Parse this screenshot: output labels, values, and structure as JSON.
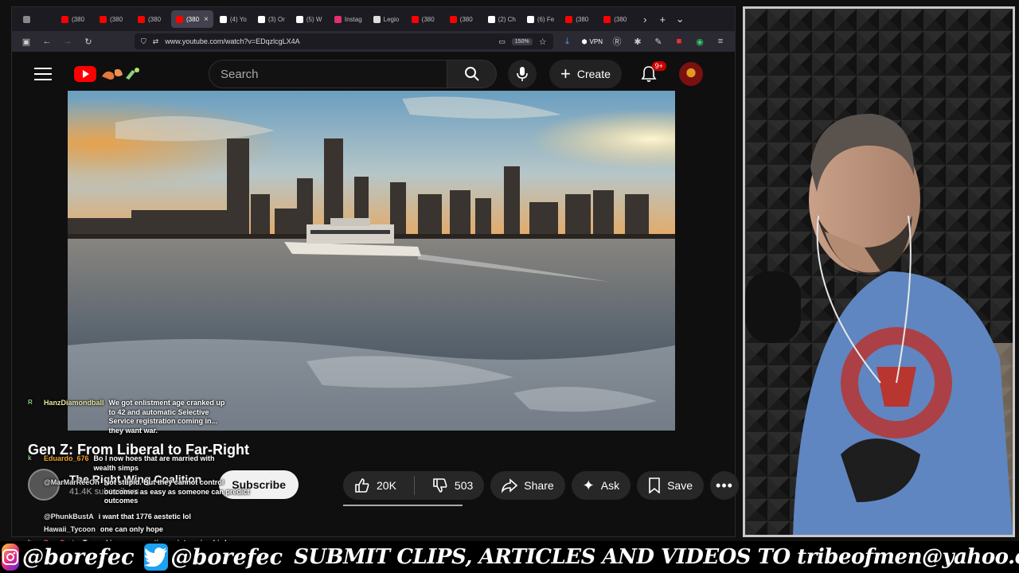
{
  "browser": {
    "tabs": [
      {
        "label": "",
        "icon": "tabs-icon",
        "color": "#888888"
      },
      {
        "label": "(380",
        "icon": "youtube-icon",
        "color": "#ff0000"
      },
      {
        "label": "(380",
        "icon": "youtube-icon",
        "color": "#ff0000"
      },
      {
        "label": "(380",
        "icon": "youtube-icon",
        "color": "#ff0000"
      },
      {
        "label": "(380",
        "icon": "youtube-icon",
        "color": "#ff0000",
        "active": true
      },
      {
        "label": "(4) Yo",
        "icon": "x-icon",
        "color": "#ffffff"
      },
      {
        "label": "(3) Or",
        "icon": "x-icon",
        "color": "#ffffff"
      },
      {
        "label": "(5) W",
        "icon": "x-icon",
        "color": "#ffffff"
      },
      {
        "label": "Instag",
        "icon": "instagram-icon",
        "color": "#e1306c"
      },
      {
        "label": "Legio",
        "icon": "legion-icon",
        "color": "#dddddd"
      },
      {
        "label": "(380",
        "icon": "youtube-icon",
        "color": "#ff0000"
      },
      {
        "label": "(380",
        "icon": "youtube-icon",
        "color": "#ff0000"
      },
      {
        "label": "(2) Ch",
        "icon": "x-icon",
        "color": "#ffffff"
      },
      {
        "label": "(6) Fe",
        "icon": "x-icon",
        "color": "#ffffff"
      },
      {
        "label": "(380",
        "icon": "youtube-icon",
        "color": "#ff0000"
      },
      {
        "label": "(380",
        "icon": "youtube-icon",
        "color": "#ff0000"
      }
    ],
    "url": "www.youtube.com/watch?v=EDqzlcgLX4A",
    "zoom": "150%",
    "vpn": "VPN"
  },
  "youtube": {
    "search_placeholder": "Search",
    "create_label": "Create",
    "notification_count": "9+",
    "video_title": "Gen Z: From Liberal to Far-Right",
    "channel_name": "The Right Wing Coalition",
    "subscribers": "41.4K subscribers",
    "subscribe_label": "Subscribe",
    "likes": "20K",
    "dislikes": "503",
    "share_label": "Share",
    "ask_label": "Ask",
    "save_label": "Save"
  },
  "chat": [
    {
      "user": "HanzDiamondball",
      "color": "#e8e8a0",
      "badge": "R",
      "text": "We got enlistment age cranked up to 42 and automatic Selective Service registration coming in... they want war."
    },
    {
      "user": "Eduardo_676",
      "color": "#f0a030",
      "badge": "k",
      "text": "Bo I now hoes that are married with wealth simps"
    },
    {
      "user": "@MarMarReeOh",
      "color": "#e8e8e8",
      "badge": "",
      "text": "Not stupid. But they cannot control outcomes as easy as someone can predict outcomes"
    },
    {
      "user": "@PhunkBustA",
      "color": "#e8e8e8",
      "badge": "",
      "text": "i want that 1776 aestetic lol"
    },
    {
      "user": "Hawaii_Tycoon",
      "color": "#e8e8e8",
      "badge": "",
      "text": "one can only hope"
    },
    {
      "user": "PropDude",
      "color": "#e05050",
      "badge": "k",
      "text": "Try making conservative points using bird hands. I need a laugh."
    }
  ],
  "banner": {
    "instagram_handle": "@borefec",
    "twitter_handle": "@borefec",
    "text": "SUBMIT CLIPS, ARTICLES AND VIDEOS TO tribeofmen@yahoo.com"
  }
}
